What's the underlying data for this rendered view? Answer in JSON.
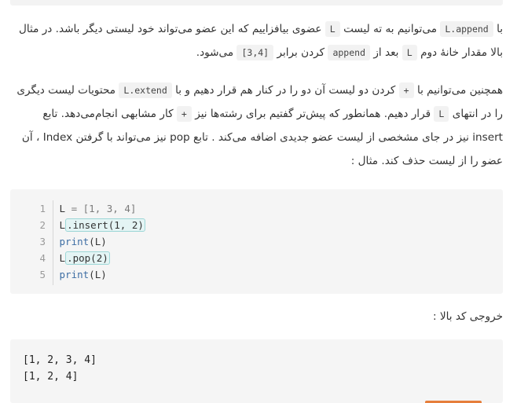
{
  "para1": {
    "p1": "با",
    "c1": "L.append",
    "p2": "می‌توانیم به ته لیست",
    "c2": "L",
    "p3": "عضوی بیافزاییم که این عضو می‌تواند خود لیستی دیگر باشد. در مثال بالا مقدار خانهٔ دوم",
    "c3": "L",
    "p4": "بعد از",
    "c4": "append",
    "p5": "کردن برابر",
    "c5": "[3,4]",
    "p6": "می‌شود."
  },
  "para2": {
    "p1": "همچنین می‌توانیم با",
    "c1": "+",
    "p2": "کردن دو لیست آن دو را در کنار هم قرار دهیم و با",
    "c2": "L.extend",
    "p3": "محتویات لیست دیگری را در انتهای",
    "c3": "L",
    "p4": "قرار دهیم. همانطور که پیش‌تر گفتیم برای رشته‌ها نیز",
    "c4": "+",
    "p5": "کار مشابهی انجام‌می‌دهد. تابع insert نیز در جای مشخصی از لیست عضو جدیدی اضافه می‌کند . تابع pop نیز می‌تواند با گرفتن Index ، آن عضو را از لیست حذف کند. مثال :"
  },
  "code": {
    "line_numbers": [
      "1",
      "2",
      "3",
      "4",
      "5"
    ],
    "l1": {
      "var": "L",
      "eq": " = ",
      "list": "[1, 3, 4]"
    },
    "l2": {
      "var": "L",
      "call": ".insert(1, 2)"
    },
    "l3": {
      "fn": "print",
      "args": "(L)"
    },
    "l4": {
      "var": "L",
      "call": ".pop(2)"
    },
    "l5": {
      "fn": "print",
      "args": "(L)"
    }
  },
  "output_label": "خروجی کد بالا :",
  "output_lines": [
    "[1, 2, 3, 4]",
    "[1, 2, 4]"
  ],
  "colors": {
    "accent": "#e67e3b",
    "keyword": "#3e6ea4",
    "highlight_bg": "#e4f4f4"
  }
}
